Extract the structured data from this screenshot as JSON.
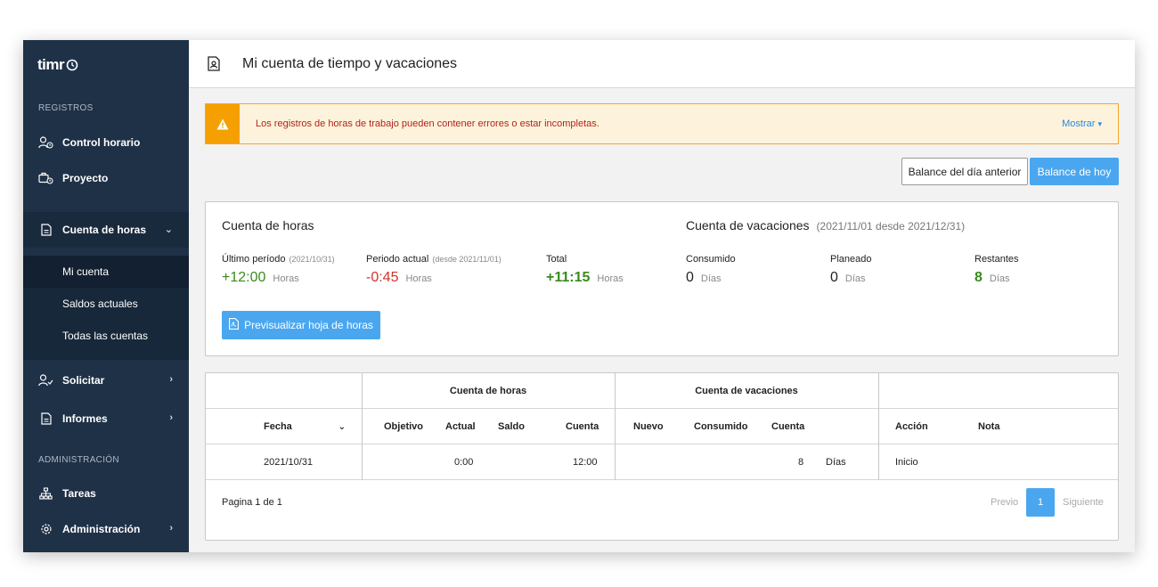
{
  "app": {
    "logo_text": "timr"
  },
  "sidebar": {
    "section_registros": "REGISTROS",
    "section_admin": "ADMINISTRACIÓN",
    "items": {
      "control_horario": "Control horario",
      "proyecto": "Proyecto",
      "cuenta_horas": "Cuenta de horas",
      "mi_cuenta": "Mi cuenta",
      "saldos_actuales": "Saldos actuales",
      "todas_cuentas": "Todas las cuentas",
      "solicitar": "Solicitar",
      "informes": "Informes",
      "tareas": "Tareas",
      "administracion": "Administración"
    }
  },
  "header": {
    "title": "Mi cuenta de tiempo y vacaciones"
  },
  "alert": {
    "text": "Los registros de horas de trabajo pueden contener errores o estar incompletas.",
    "link": "Mostrar"
  },
  "buttons": {
    "balance_anterior": "Balance del día anterior",
    "balance_hoy": "Balance de hoy",
    "previsualizar": "Previsualizar hoja de horas"
  },
  "hours": {
    "title": "Cuenta de horas",
    "ultimo_label": "Último período",
    "ultimo_range": "(2021/10/31)",
    "ultimo_value": "+12:00",
    "actual_label": "Periodo actual",
    "actual_range": "(desde 2021/11/01)",
    "actual_value": "-0:45",
    "total_label": "Total",
    "total_value": "+11:15",
    "unit": "Horas"
  },
  "vacation": {
    "title": "Cuenta de vacaciones",
    "range": "(2021/11/01 desde 2021/12/31)",
    "consumido_label": "Consumido",
    "consumido_value": "0",
    "planeado_label": "Planeado",
    "planeado_value": "0",
    "restantes_label": "Restantes",
    "restantes_value": "8",
    "unit": "Días"
  },
  "table": {
    "group_headers": {
      "horas": "Cuenta de horas",
      "vacaciones": "Cuenta de vacaciones"
    },
    "columns": {
      "fecha": "Fecha",
      "objetivo": "Objetivo",
      "actual": "Actual",
      "saldo": "Saldo",
      "cuenta": "Cuenta",
      "nuevo": "Nuevo",
      "consumido": "Consumido",
      "cuenta_vac": "Cuenta",
      "accion": "Acción",
      "nota": "Nota"
    },
    "rows": [
      {
        "fecha": "2021/10/31",
        "objetivo": "",
        "actual": "0:00",
        "saldo": "",
        "cuenta": "12:00",
        "nuevo": "",
        "consumido": "",
        "cuenta_vac": "8",
        "unidad": "Días",
        "accion": "Inicio",
        "nota": ""
      }
    ]
  },
  "pagination": {
    "text": "Pagina 1 de 1",
    "prev": "Previo",
    "page": "1",
    "next": "Siguiente"
  }
}
